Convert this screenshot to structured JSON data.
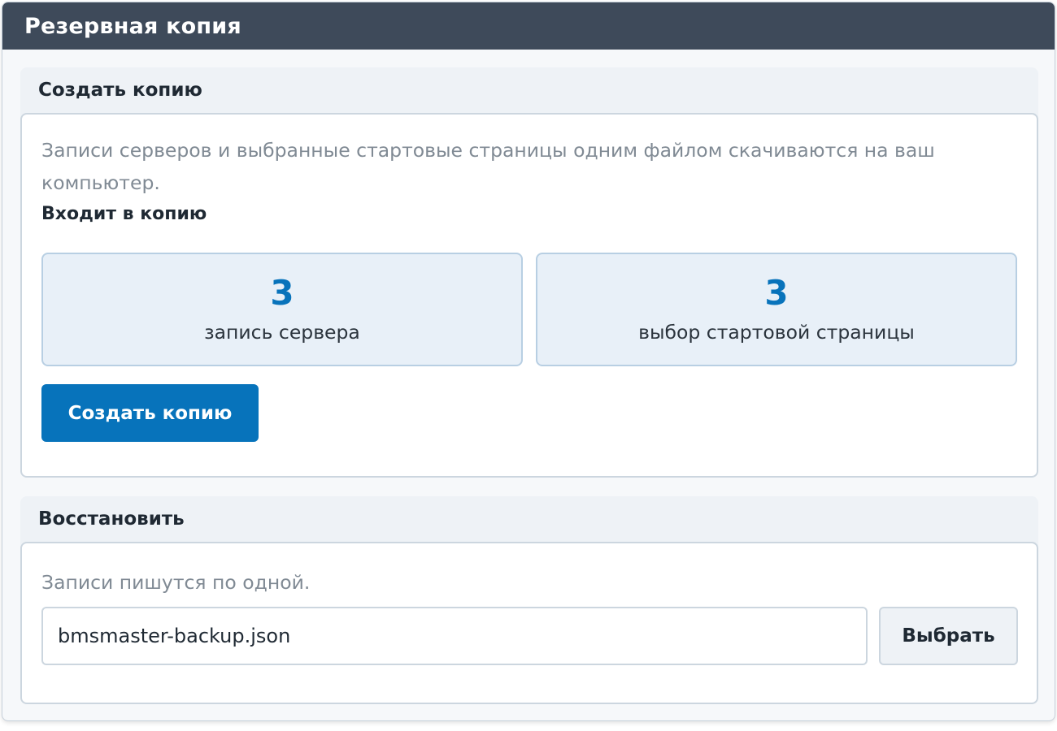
{
  "window": {
    "title": "Резервная копия"
  },
  "create": {
    "header": "Создать копию",
    "description": "Записи серверов и выбранные стартовые страницы одним файлом скачиваются на ваш компьютер.",
    "includes_heading": "Входит в копию",
    "stats": [
      {
        "value": "3",
        "label": "запись сервера"
      },
      {
        "value": "3",
        "label": "выбор стартовой страницы"
      }
    ],
    "button_label": "Создать копию"
  },
  "restore": {
    "header": "Восстановить",
    "description": "Записи пишутся по одной.",
    "file_value": "bmsmaster-backup.json",
    "choose_label": "Выбрать"
  },
  "colors": {
    "titlebar": "#3e4a5a",
    "accent": "#0773bb",
    "stat_bg": "#e8f0f8",
    "muted_text": "#808a94"
  }
}
